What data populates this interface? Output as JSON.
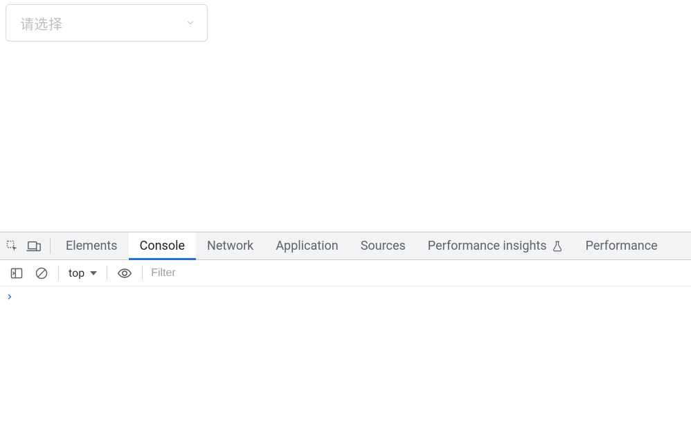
{
  "page": {
    "select_placeholder": "请选择"
  },
  "devtools": {
    "tabs": {
      "elements": "Elements",
      "console": "Console",
      "network": "Network",
      "application": "Application",
      "sources": "Sources",
      "performance_insights": "Performance insights",
      "performance": "Performance"
    },
    "toolbar": {
      "context": "top",
      "filter_placeholder": "Filter"
    }
  }
}
